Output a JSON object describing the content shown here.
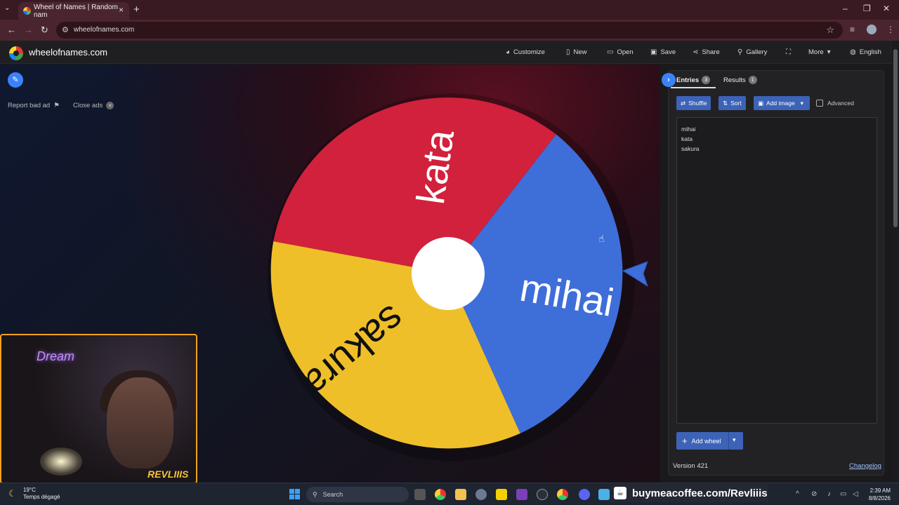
{
  "browser": {
    "tab_title": "Wheel of Names | Random nam",
    "url": "wheelofnames.com"
  },
  "site": {
    "brand": "wheelofnames.com",
    "menu": [
      {
        "label": "Customize",
        "icon": "palette-icon"
      },
      {
        "label": "New",
        "icon": "file-icon"
      },
      {
        "label": "Open",
        "icon": "folder-icon"
      },
      {
        "label": "Save",
        "icon": "save-icon"
      },
      {
        "label": "Share",
        "icon": "share-icon"
      },
      {
        "label": "Gallery",
        "icon": "search-icon"
      },
      {
        "label": "",
        "icon": "fullscreen-icon"
      },
      {
        "label": "More",
        "icon": "chevron-down-icon"
      },
      {
        "label": "English",
        "icon": "globe-icon"
      }
    ]
  },
  "ads": {
    "report": "Report bad ad",
    "close": "Close ads"
  },
  "wheel": {
    "segments": [
      {
        "name": "kata",
        "color": "#d1213c"
      },
      {
        "name": "mihai",
        "color": "#3e6ed8"
      },
      {
        "name": "sakura",
        "color": "#efbf2a"
      }
    ]
  },
  "panel": {
    "tabs": [
      {
        "label": "Entries",
        "count": "3"
      },
      {
        "label": "Results",
        "count": "1"
      }
    ],
    "buttons": {
      "shuffle": "Shuffle",
      "sort": "Sort",
      "add_image": "Add image",
      "advanced": "Advanced"
    },
    "entries": [
      "mihai",
      "kata",
      "sakura"
    ],
    "add_wheel": "Add wheel",
    "version": "Version 421",
    "changelog": "Changelog"
  },
  "overlay": {
    "neon_sign": "Dream",
    "streamer_tag": "REVLIIIS",
    "promo": "buymeacoffee.com/Revliiis"
  },
  "taskbar": {
    "weather_temp": "19°C",
    "weather_desc": "Temps dégagé",
    "search": "Search",
    "time": "2:39 AM",
    "date": "8/8/2026"
  },
  "colors": {
    "accent": "#3b82f6",
    "button": "#3c63b8"
  }
}
